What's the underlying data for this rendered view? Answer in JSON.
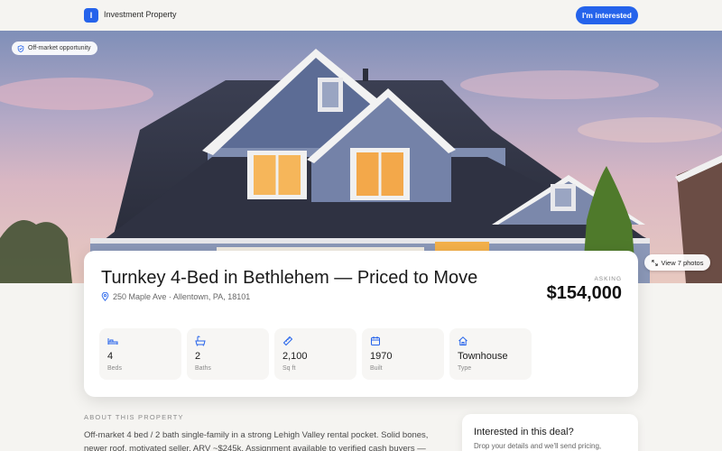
{
  "header": {
    "logo_letter": "I",
    "brand": "Investment Property",
    "cta_label": "I'm interested"
  },
  "hero": {
    "badge": "Off-market opportunity",
    "photos_button": "View 7 photos"
  },
  "listing": {
    "title": "Turnkey 4-Bed in Bethlehem — Priced to Move",
    "address": "250 Maple Ave · Allentown, PA, 18101",
    "asking_label": "ASKING",
    "price": "$154,000",
    "stats": [
      {
        "icon": "bed-icon",
        "value": "4",
        "label": "Beds"
      },
      {
        "icon": "bath-icon",
        "value": "2",
        "label": "Baths"
      },
      {
        "icon": "ruler-icon",
        "value": "2,100",
        "label": "Sq ft"
      },
      {
        "icon": "calendar-icon",
        "value": "1970",
        "label": "Built"
      },
      {
        "icon": "home-icon",
        "value": "Townhouse",
        "label": "Type"
      }
    ]
  },
  "about": {
    "heading": "ABOUT THIS PROPERTY",
    "text": "Off-market 4 bed / 2 bath single-family in a strong Lehigh Valley rental pocket. Solid bones, newer roof, motivated seller. ARV ~$245k. Assignment available to verified cash buyers —"
  },
  "side": {
    "heading": "Interested in this deal?",
    "text": "Drop your details and we'll send pricing,"
  },
  "colors": {
    "accent": "#2563eb",
    "background": "#f5f4f1"
  }
}
